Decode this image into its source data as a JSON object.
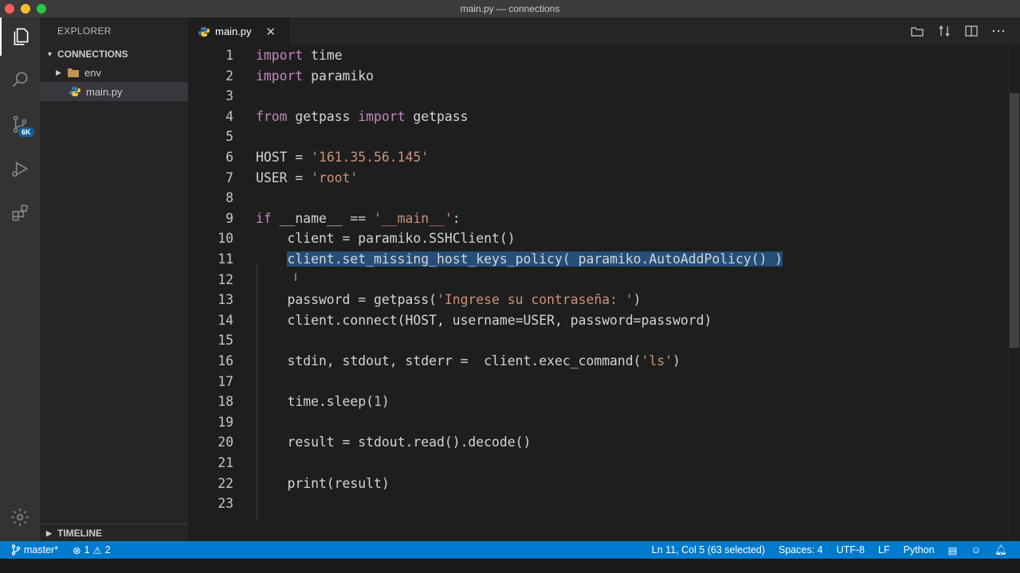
{
  "window": {
    "title": "main.py — connections"
  },
  "sidebar": {
    "title": "EXPLORER",
    "folder": "CONNECTIONS",
    "items": [
      {
        "label": "env",
        "type": "folder"
      },
      {
        "label": "main.py",
        "type": "python-file"
      }
    ],
    "timeline": "TIMELINE"
  },
  "activity": {
    "scm_badge": "6K"
  },
  "editor": {
    "tab": "main.py",
    "lines": [
      {
        "n": "1",
        "tokens": [
          [
            "kwp",
            "import"
          ],
          [
            "t",
            " time"
          ]
        ]
      },
      {
        "n": "2",
        "tokens": [
          [
            "kwp",
            "import"
          ],
          [
            "t",
            " paramiko"
          ]
        ]
      },
      {
        "n": "3",
        "tokens": []
      },
      {
        "n": "4",
        "tokens": [
          [
            "kwp",
            "from"
          ],
          [
            "t",
            " getpass "
          ],
          [
            "kwp",
            "import"
          ],
          [
            "t",
            " getpass"
          ]
        ]
      },
      {
        "n": "5",
        "tokens": []
      },
      {
        "n": "6",
        "tokens": [
          [
            "t",
            "HOST = "
          ],
          [
            "str",
            "'161.35.56.145'"
          ]
        ]
      },
      {
        "n": "7",
        "tokens": [
          [
            "t",
            "USER = "
          ],
          [
            "str",
            "'root'"
          ]
        ]
      },
      {
        "n": "8",
        "tokens": []
      },
      {
        "n": "9",
        "tokens": [
          [
            "kwp",
            "if"
          ],
          [
            "t",
            " __name__ == "
          ],
          [
            "str",
            "'__main__'"
          ],
          [
            "t",
            ":"
          ]
        ]
      },
      {
        "n": "10",
        "tokens": [
          [
            "t",
            "    client = paramiko.SSHClient()"
          ]
        ]
      },
      {
        "n": "11",
        "tokens": [
          [
            "t",
            "    "
          ],
          [
            "sel",
            "client.set_missing_host_keys_policy( paramiko.AutoAddPolicy() )"
          ]
        ]
      },
      {
        "n": "12",
        "tokens": []
      },
      {
        "n": "13",
        "tokens": [
          [
            "t",
            "    password = getpass("
          ],
          [
            "str",
            "'Ingrese su contraseña: '"
          ],
          [
            "t",
            ")"
          ]
        ]
      },
      {
        "n": "14",
        "tokens": [
          [
            "t",
            "    client.connect(HOST, username=USER, password=password)"
          ]
        ]
      },
      {
        "n": "15",
        "tokens": []
      },
      {
        "n": "16",
        "tokens": [
          [
            "t",
            "    stdin, stdout, stderr =  client.exec_command("
          ],
          [
            "str",
            "'ls'"
          ],
          [
            "t",
            ")"
          ]
        ]
      },
      {
        "n": "17",
        "tokens": []
      },
      {
        "n": "18",
        "tokens": [
          [
            "t",
            "    time.sleep("
          ],
          [
            "num",
            "1"
          ],
          [
            "t",
            ")"
          ]
        ]
      },
      {
        "n": "19",
        "tokens": []
      },
      {
        "n": "20",
        "tokens": [
          [
            "t",
            "    result = stdout.read().decode()"
          ]
        ]
      },
      {
        "n": "21",
        "tokens": []
      },
      {
        "n": "22",
        "tokens": [
          [
            "t",
            "    print(result)"
          ]
        ]
      },
      {
        "n": "23",
        "tokens": []
      }
    ]
  },
  "status": {
    "branch": "master*",
    "errors": "1",
    "warnings": "2",
    "position": "Ln 11, Col 5 (63 selected)",
    "spaces": "Spaces: 4",
    "encoding": "UTF-8",
    "eol": "LF",
    "language": "Python"
  },
  "colors": {
    "accent": "#007acc",
    "keyword": "#c586c0",
    "string": "#ce9178",
    "number": "#b5cea8",
    "selection": "#264f78"
  }
}
